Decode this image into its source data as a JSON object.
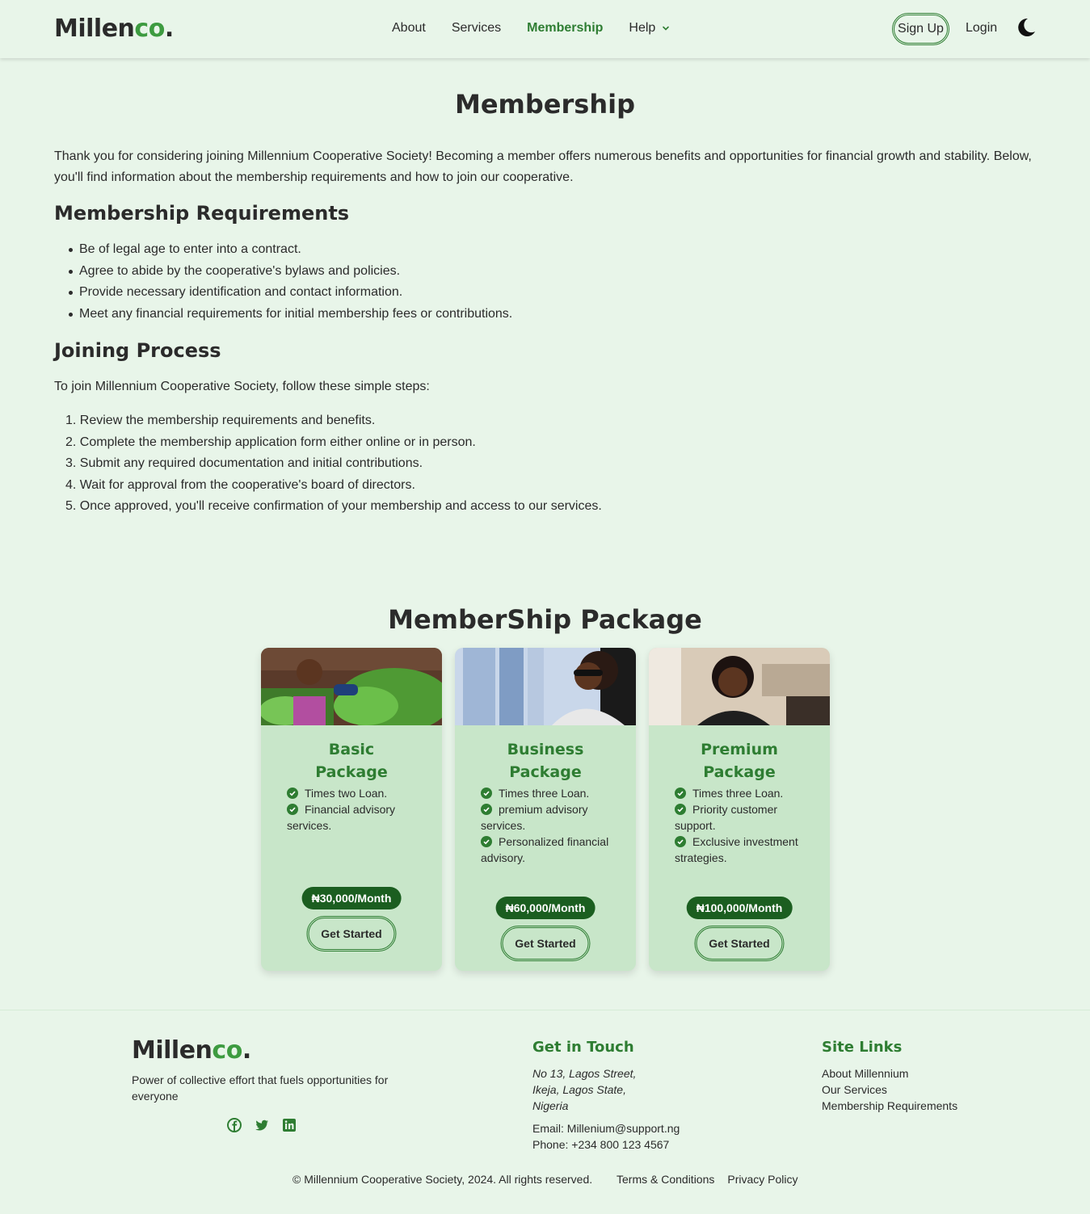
{
  "nav": {
    "logo_main": "Millen",
    "logo_accent": "co",
    "logo_dot": ".",
    "links": [
      "About",
      "Services",
      "Membership",
      "Help"
    ],
    "signup": "Sign Up",
    "login": "Login"
  },
  "main": {
    "title": "Membership",
    "intro": "Thank you for considering joining Millennium Cooperative Society! Becoming a member offers numerous benefits and opportunities for financial growth and stability. Below, you'll find information about the membership requirements and how to join our cooperative.",
    "requirements_heading": "Membership Requirements",
    "requirements": [
      "Be of legal age to enter into a contract.",
      "Agree to abide by the cooperative's bylaws and policies.",
      "Provide necessary identification and contact information.",
      "Meet any financial requirements for initial membership fees or contributions."
    ],
    "process_heading": "Joining Process",
    "process_intro": "To join Millennium Cooperative Society, follow these simple steps:",
    "steps": [
      "1. Review the membership requirements and benefits.",
      "2. Complete the membership application form either online or in person.",
      "3. Submit any required documentation and initial contributions.",
      "4. Wait for approval from the cooperative's board of directors.",
      "5. Once approved, you'll receive confirmation of your membership and access to our services."
    ]
  },
  "packages": {
    "title": "MemberShip Package",
    "cards": [
      {
        "name": "Basic Package",
        "features": [
          "Times two Loan.",
          "Financial advisory services."
        ],
        "price": "₦30,000/Month",
        "cta": "Get Started"
      },
      {
        "name": "Business Package",
        "features": [
          "Times three Loan.",
          "premium advisory services.",
          "Personalized financial advisory."
        ],
        "price": "₦60,000/Month",
        "cta": "Get Started"
      },
      {
        "name": "Premium Package",
        "features": [
          "Times three Loan.",
          "Priority customer support.",
          "Exclusive investment strategies."
        ],
        "price": "₦100,000/Month",
        "cta": "Get Started"
      }
    ]
  },
  "footer": {
    "logo_main": "Millen",
    "logo_accent": "co",
    "logo_dot": ".",
    "tagline": "Power of collective effort that fuels opportunities for everyone",
    "contact_heading": "Get in Touch",
    "address": [
      "No 13, Lagos Street,",
      "Ikeja, Lagos State,",
      "Nigeria"
    ],
    "email": "Email: Millenium@support.ng",
    "phone": "Phone: +234 800 123 4567",
    "links_heading": "Site Links",
    "links": [
      "About Millennium",
      "Our Services",
      "Membership Requirements"
    ],
    "copyright": "© Millennium Cooperative Society, 2024. All rights reserved.",
    "terms": "Terms & Conditions",
    "privacy": "Privacy Policy"
  },
  "colors": {
    "background": "#e8f5e9",
    "accent": "#2e7d32",
    "card": "#c8e6c9",
    "price_badge": "#1b5e20"
  },
  "icons": [
    "chevron-down-icon",
    "moon-icon",
    "check-circle-icon",
    "facebook-icon",
    "twitter-icon",
    "linkedin-icon"
  ]
}
